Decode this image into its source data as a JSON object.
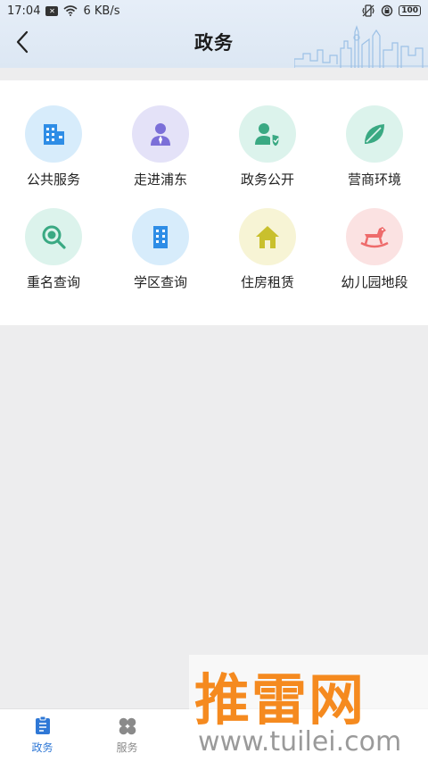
{
  "status_bar": {
    "time": "17:04",
    "notif_badge": "✕",
    "net_speed": "6 KB/s",
    "battery": "100"
  },
  "header": {
    "title": "政务"
  },
  "grid": {
    "items": [
      {
        "label": "公共服务",
        "icon": "building-icon",
        "bg": "#d7ecfb",
        "fg": "#2e8de6"
      },
      {
        "label": "走进浦东",
        "icon": "person-icon",
        "bg": "#e4e2f8",
        "fg": "#7b6fd8"
      },
      {
        "label": "政务公开",
        "icon": "user-shield-icon",
        "bg": "#dcf3ec",
        "fg": "#3aa983"
      },
      {
        "label": "营商环境",
        "icon": "leaf-icon",
        "bg": "#dcf3ec",
        "fg": "#3aa983"
      },
      {
        "label": "重名查询",
        "icon": "magnifier-icon",
        "bg": "#dcf3ec",
        "fg": "#3aa983"
      },
      {
        "label": "学区查询",
        "icon": "office-building-icon",
        "bg": "#d7ecfb",
        "fg": "#2e8de6"
      },
      {
        "label": "住房租赁",
        "icon": "house-icon",
        "bg": "#f7f4d5",
        "fg": "#c9c02d"
      },
      {
        "label": "幼儿园地段",
        "icon": "rocking-horse-icon",
        "bg": "#fbe2e2",
        "fg": "#ee6b6b"
      }
    ]
  },
  "bottom_nav": {
    "tabs": [
      {
        "label": "政务",
        "active": true
      },
      {
        "label": "服务",
        "active": false
      }
    ]
  },
  "watermark": {
    "brand": "推雷网",
    "url": "www.tuilei.com"
  },
  "colors": {
    "active_tab": "#2f78d6",
    "inactive_tab": "#8a8a8a",
    "watermark_orange": "#f58a1f"
  }
}
